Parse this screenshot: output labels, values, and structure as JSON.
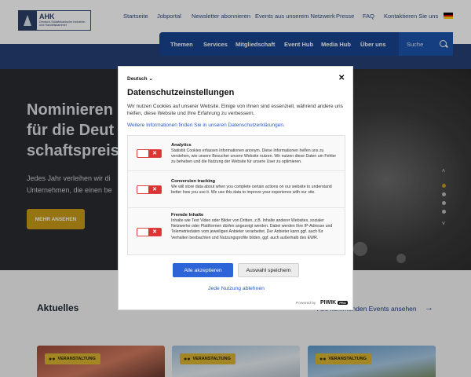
{
  "logo": {
    "abbr": "AHK",
    "subtitle": "Deutsch-Südafrikanische Industrie- und Handelskammer"
  },
  "topnav": {
    "items": [
      "Startseite",
      "Jobportal",
      "Newsletter abonnieren",
      "Events aus unserem Netzwerk",
      "Presse",
      "FAQ",
      "Kontaktieren Sie uns"
    ]
  },
  "mainnav": {
    "items": [
      "Themen",
      "Services",
      "Mitgliedschaft",
      "Event Hub",
      "Media Hub",
      "Über uns"
    ],
    "search_label": "Suche"
  },
  "hero": {
    "title_line1": "Nominieren",
    "title_line2": "für die Deut",
    "title_line3": "schaftspreis",
    "lead_line1": "Jedes Jahr verleihen wir di",
    "lead_line2": "Unternehmen, die einen be",
    "cta": "MEHR ANSEHEN"
  },
  "aktuelles": {
    "title": "Aktuelles",
    "more_link": "Alle kommenden Events ansehen",
    "cards": [
      {
        "badge": "VERANSTALTUNG"
      },
      {
        "badge": "VERANSTALTUNG"
      },
      {
        "badge": "VERANSTALTUNG"
      }
    ]
  },
  "consent": {
    "language": "Deutsch",
    "title": "Datenschutzeinstellungen",
    "intro": "Wir nutzen Cookies auf unserer Website. Einige von ihnen sind essenziell, während andere uns helfen, diese Website und Ihre Erfahrung zu verbessern.",
    "info_link": "Weitere Informationen finden Sie in unseren Datenschutzerklärungen.",
    "categories": [
      {
        "title": "Analytics",
        "description": "Statistik Cookies erfassen Informationen anonym. Diese Informationen helfen uns zu verstehen, wie unsere Besucher unsere Website nutzen. Wir nutzen diese Daten um Fehler zu beheben und die Nutzung der Website für unsere User zu optimieren.",
        "enabled": false
      },
      {
        "title": "Conversion tracking",
        "description": "We will store data about when you complete certain actions on our website to understand better how you use it. We use this data to improve your experience with our site.",
        "enabled": false
      },
      {
        "title": "Fremde Inhalte",
        "description": "Inhalte wie Text Video oder Bilder von Dritten, z.B. Inhalte anderer Websites, sozialer Netzwerke oder Plattformen dürfen angezeigt werden. Dabei werden Ihre IP-Adresse und Telemetriedaten vom jeweiligen Anbieter verarbeitet. Der Anbieter kann ggf. auch für Verhalten beobachten und Nutzungsprofile bilden, ggf. auch außerhalb des EWR.",
        "enabled": false
      }
    ],
    "accept_all": "Alle akzeptieren",
    "save_selection": "Auswahl speichern",
    "deny_all": "Jede Nutzung ablehnen",
    "powered_by": "Powered by",
    "brand": "PIWIK",
    "brand_badge": "PRO"
  },
  "colors": {
    "primary_blue": "#17438e",
    "gold": "#c79b17",
    "accept_blue": "#2d64d8",
    "toggle_off_red": "#dd3333"
  }
}
